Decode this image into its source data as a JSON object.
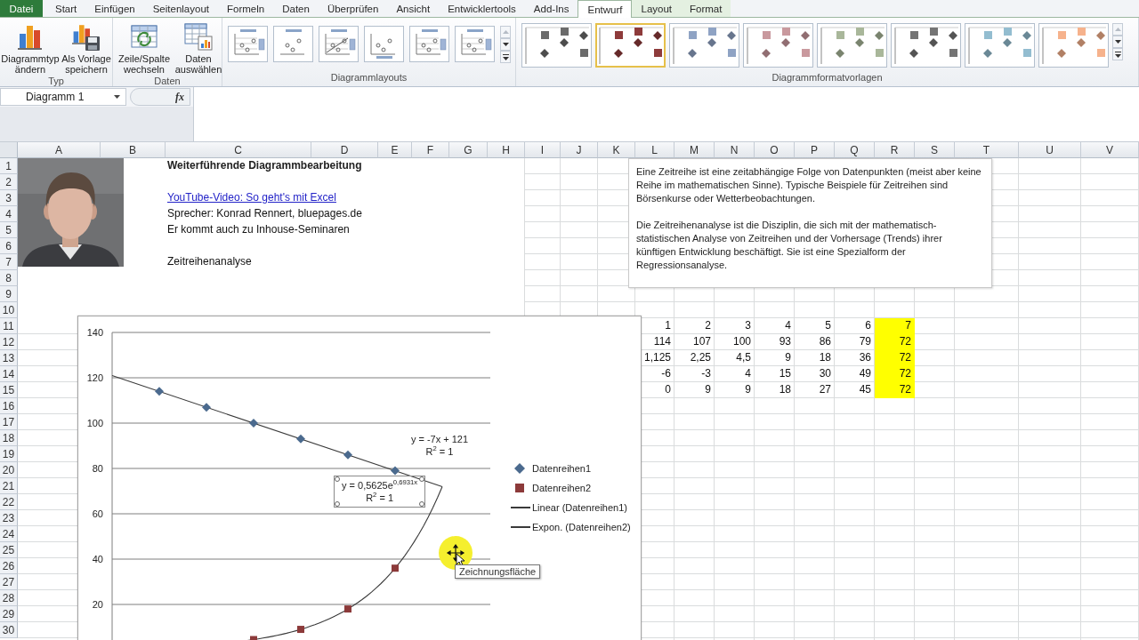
{
  "tabs": [
    {
      "label": "Datei",
      "kind": "file",
      "selected": false
    },
    {
      "label": "Start",
      "kind": "standard",
      "selected": false
    },
    {
      "label": "Einfügen",
      "kind": "standard",
      "selected": false
    },
    {
      "label": "Seitenlayout",
      "kind": "standard",
      "selected": false
    },
    {
      "label": "Formeln",
      "kind": "standard",
      "selected": false
    },
    {
      "label": "Daten",
      "kind": "standard",
      "selected": false
    },
    {
      "label": "Überprüfen",
      "kind": "standard",
      "selected": false
    },
    {
      "label": "Ansicht",
      "kind": "standard",
      "selected": false
    },
    {
      "label": "Entwicklertools",
      "kind": "standard",
      "selected": false
    },
    {
      "label": "Add-Ins",
      "kind": "standard",
      "selected": false
    },
    {
      "label": "Entwurf",
      "kind": "contextual",
      "selected": true
    },
    {
      "label": "Layout",
      "kind": "contextual",
      "selected": false
    },
    {
      "label": "Format",
      "kind": "contextual",
      "selected": false
    }
  ],
  "ribbon": {
    "groups": [
      {
        "label": "Typ",
        "kind": "buttons",
        "buttons": [
          {
            "label": "Diagrammtyp ändern",
            "kind": "chart-type"
          },
          {
            "label": "Als Vorlage speichern",
            "kind": "save-template"
          }
        ]
      },
      {
        "label": "Daten",
        "kind": "buttons",
        "buttons": [
          {
            "label": "Zeile/Spalte wechseln",
            "kind": "switch"
          },
          {
            "label": "Daten auswählen",
            "kind": "select-data"
          }
        ]
      },
      {
        "label": "Diagrammlayouts",
        "kind": "layouts",
        "items": [
          {
            "selected": false
          },
          {
            "selected": false
          },
          {
            "selected": false
          },
          {
            "selected": false
          },
          {
            "selected": false
          },
          {
            "selected": false
          }
        ]
      },
      {
        "label": "Diagrammformatvorlagen",
        "kind": "styles",
        "items": [
          {
            "color": "#6b6b6b",
            "selected": false
          },
          {
            "color": "#8e3b3b",
            "selected": true
          },
          {
            "color": "#8fa3c4",
            "selected": false
          },
          {
            "color": "#c9999e",
            "selected": false
          },
          {
            "color": "#a9b79a",
            "selected": false
          },
          {
            "color": "#747474",
            "selected": false
          },
          {
            "color": "#93bdd0",
            "selected": false
          },
          {
            "color": "#f6b28c",
            "selected": false
          }
        ]
      }
    ]
  },
  "formula_bar": {
    "name_box": "Diagramm 1",
    "function_button": "fx"
  },
  "sheet": {
    "columns": [
      "A",
      "B",
      "C",
      "D",
      "E",
      "F",
      "G",
      "H",
      "I",
      "J",
      "K",
      "L",
      "M",
      "N",
      "O",
      "P",
      "Q",
      "R",
      "S",
      "T",
      "U",
      "V"
    ],
    "rows": [
      "1",
      "2",
      "3",
      "4",
      "5",
      "6",
      "7",
      "8",
      "9",
      "10",
      "11",
      "12",
      "13",
      "14",
      "15",
      "16",
      "17",
      "18",
      "19",
      "20",
      "21",
      "22",
      "23",
      "24",
      "25",
      "26",
      "27",
      "28",
      "29",
      "30"
    ],
    "intro": [
      {
        "text": "Weiterführende Diagrammbearbeitung",
        "kind": "heading"
      },
      {
        "text": "YouTube-Video: So geht's mit Excel",
        "kind": "link"
      },
      {
        "text": "Sprecher: Konrad Rennert, bluepages.de",
        "kind": "plain"
      },
      {
        "text": "Er kommt auch zu Inhouse-Seminaren",
        "kind": "plain"
      },
      {
        "text": "Zeitreihenanalyse",
        "kind": "plain"
      }
    ],
    "text_box": {
      "paragraphs": [
        "Eine Zeitreihe ist eine zeitabhängige Folge von Datenpunkten (meist aber keine Reihe im mathematischen Sinne). Typische Beispiele für Zeitreihen sind Börsenkurse oder Wetterbeobachtungen.",
        "Die Zeitreihenanalyse ist die Disziplin, die sich mit der mathematisch-statistischen Analyse von Zeitreihen und der Vorhersage (Trends) ihrer künftigen Entwicklung beschäftigt. Sie ist eine Spezialform der Regressionsanalyse."
      ]
    },
    "data_table": {
      "rows": [
        {
          "cells": [
            {
              "text": "1",
              "highlighted": false
            },
            {
              "text": "2",
              "highlighted": false
            },
            {
              "text": "3",
              "highlighted": false
            },
            {
              "text": "4",
              "highlighted": false
            },
            {
              "text": "5",
              "highlighted": false
            },
            {
              "text": "6",
              "highlighted": false
            },
            {
              "text": "7",
              "highlighted": true
            }
          ]
        },
        {
          "cells": [
            {
              "text": "114",
              "highlighted": false
            },
            {
              "text": "107",
              "highlighted": false
            },
            {
              "text": "100",
              "highlighted": false
            },
            {
              "text": "93",
              "highlighted": false
            },
            {
              "text": "86",
              "highlighted": false
            },
            {
              "text": "79",
              "highlighted": false
            },
            {
              "text": "72",
              "highlighted": true
            }
          ]
        },
        {
          "cells": [
            {
              "text": "1,125",
              "highlighted": false
            },
            {
              "text": "2,25",
              "highlighted": false
            },
            {
              "text": "4,5",
              "highlighted": false
            },
            {
              "text": "9",
              "highlighted": false
            },
            {
              "text": "18",
              "highlighted": false
            },
            {
              "text": "36",
              "highlighted": false
            },
            {
              "text": "72",
              "highlighted": true
            }
          ]
        },
        {
          "cells": [
            {
              "text": "-6",
              "highlighted": false
            },
            {
              "text": "-3",
              "highlighted": false
            },
            {
              "text": "4",
              "highlighted": false
            },
            {
              "text": "15",
              "highlighted": false
            },
            {
              "text": "30",
              "highlighted": false
            },
            {
              "text": "49",
              "highlighted": false
            },
            {
              "text": "72",
              "highlighted": true
            }
          ]
        },
        {
          "cells": [
            {
              "text": "0",
              "highlighted": false
            },
            {
              "text": "9",
              "highlighted": false
            },
            {
              "text": "9",
              "highlighted": false
            },
            {
              "text": "18",
              "highlighted": false
            },
            {
              "text": "27",
              "highlighted": false
            },
            {
              "text": "45",
              "highlighted": false
            },
            {
              "text": "72",
              "highlighted": true
            }
          ]
        }
      ]
    }
  },
  "chart": {
    "y_axis_labels": [
      "140",
      "120",
      "100",
      "80",
      "60",
      "40",
      "20"
    ],
    "legend": [
      {
        "label": "Datenreihen1",
        "kind": "diamond",
        "color": "#4b6a8e"
      },
      {
        "label": "Datenreihen2",
        "kind": "square",
        "color": "#8c3a3a"
      },
      {
        "label": "Linear (Datenreihen1)",
        "kind": "line"
      },
      {
        "label": "Expon. (Datenreihen2)",
        "kind": "line"
      }
    ],
    "trendlines": [
      {
        "kind": "linear",
        "equation": "y = -7x + 121",
        "r_squared": "R$^{2}$ = 1",
        "selected": false
      },
      {
        "kind": "exponential",
        "equation": "y = 0,5625e$^{0,6931x}$",
        "r_squared": "R$^{2}$ = 1",
        "selected": true
      }
    ],
    "tooltip": "Zeichnungsfläche"
  }
}
